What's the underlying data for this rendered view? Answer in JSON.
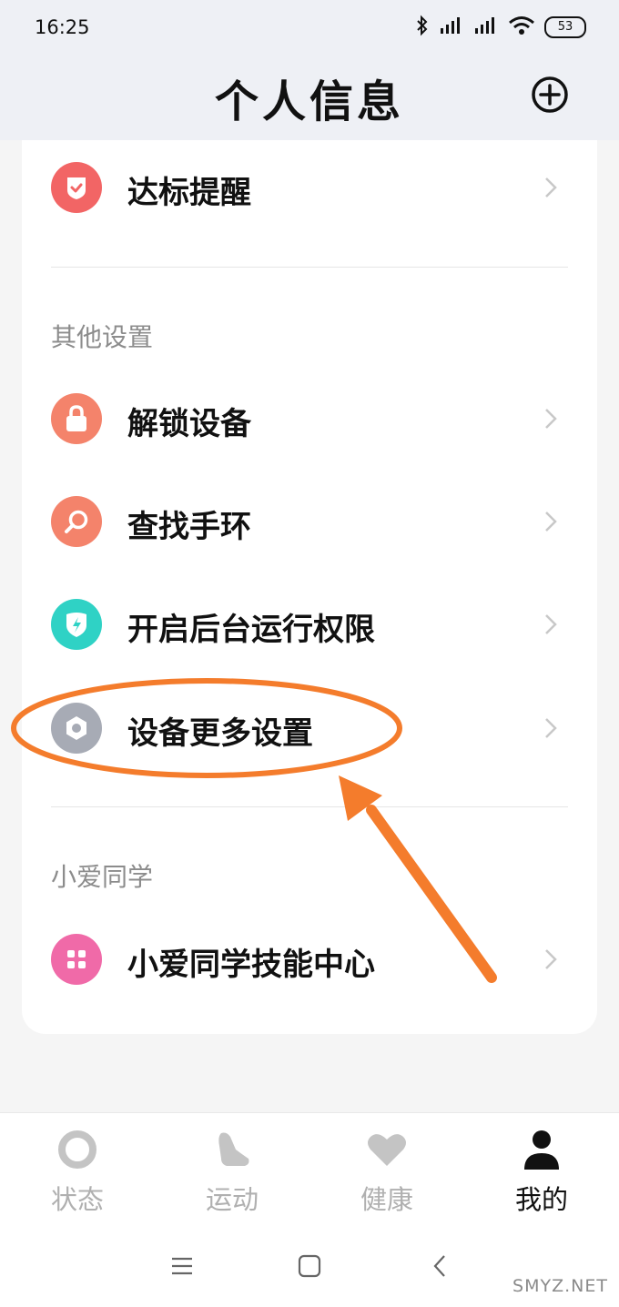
{
  "status_bar": {
    "time": "16:25",
    "battery": "53"
  },
  "header": {
    "title": "个人信息"
  },
  "rows": {
    "goal_reminder": "达标提醒",
    "unlock_device": "解锁设备",
    "find_band": "查找手环",
    "background_permission": "开启后台运行权限",
    "more_device_settings": "设备更多设置",
    "xiaoai_skills": "小爱同学技能中心"
  },
  "sections": {
    "other_settings": "其他设置",
    "xiaoai": "小爱同学"
  },
  "bottom_nav": {
    "items": [
      {
        "label": "状态",
        "icon": "status-ring-icon",
        "active": false
      },
      {
        "label": "运动",
        "icon": "shoe-icon",
        "active": false
      },
      {
        "label": "健康",
        "icon": "heart-icon",
        "active": false
      },
      {
        "label": "我的",
        "icon": "person-icon",
        "active": true
      }
    ]
  },
  "colors": {
    "goal_icon": "#f26565",
    "unlock_icon": "#f4836b",
    "find_icon": "#f4836b",
    "background_icon": "#2fd2c5",
    "settings_icon": "#a7abb5",
    "xiaoai_icon": "#f06aa8",
    "annotation": "#f47c2c"
  },
  "watermark": "SMYZ.NET"
}
